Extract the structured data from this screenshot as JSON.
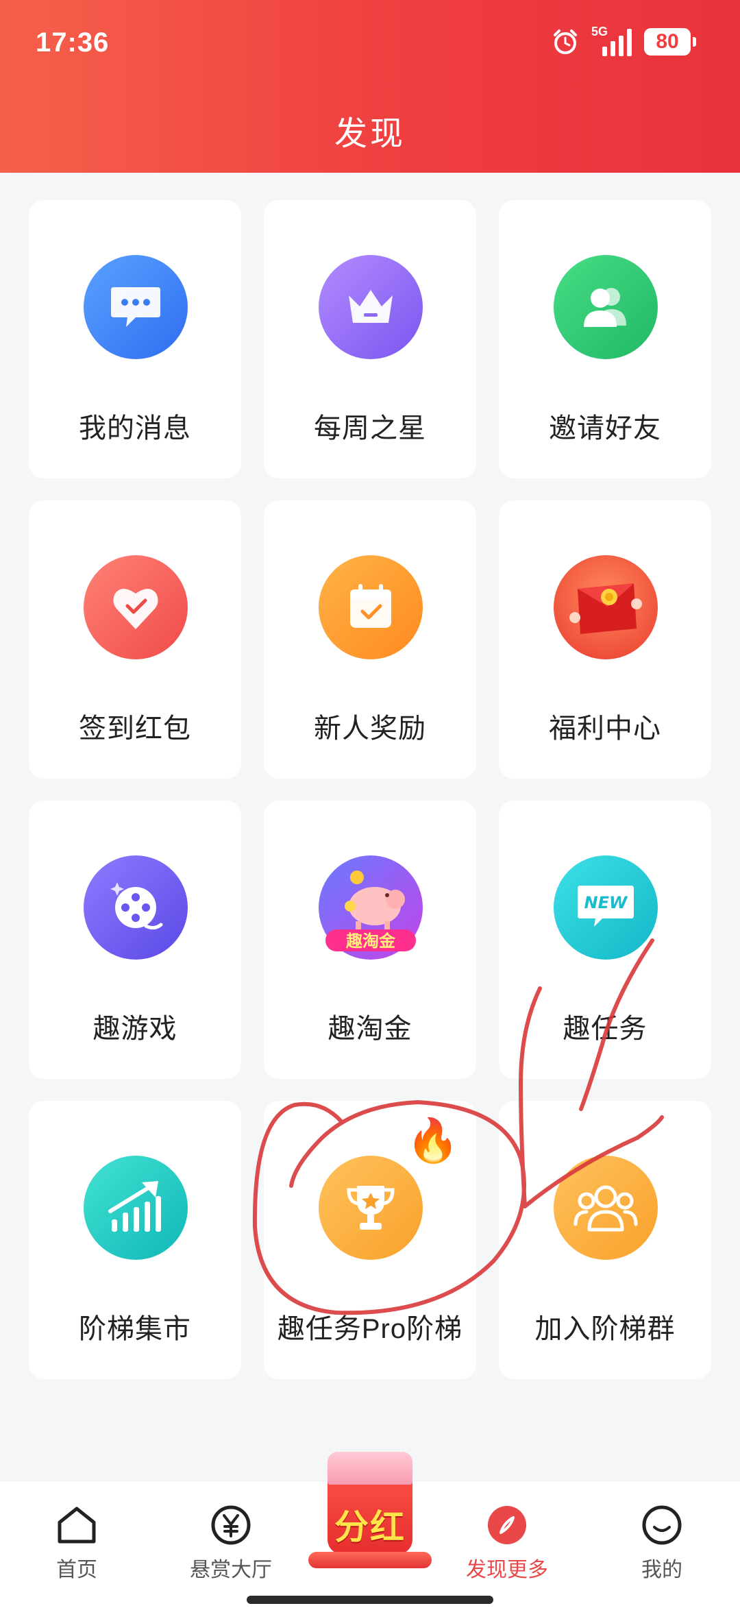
{
  "status_bar": {
    "time": "17:36",
    "network": "5G",
    "battery": "80"
  },
  "header": {
    "title": "发现"
  },
  "colors": {
    "header_start": "#f6604a",
    "header_end": "#e8323b",
    "accent_red": "#e84848",
    "annotation_red": "#d9393a"
  },
  "grid": {
    "items": [
      {
        "label": "我的消息",
        "icon": "chat-bubble-icon"
      },
      {
        "label": "每周之星",
        "icon": "crown-icon"
      },
      {
        "label": "邀请好友",
        "icon": "people-icon"
      },
      {
        "label": "签到红包",
        "icon": "heart-check-icon"
      },
      {
        "label": "新人奖励",
        "icon": "calendar-check-icon"
      },
      {
        "label": "福利中心",
        "icon": "red-envelope-icon"
      },
      {
        "label": "趣游戏",
        "icon": "film-reel-icon"
      },
      {
        "label": "趣淘金",
        "icon": "pig-coin-icon",
        "badge_text": "趣淘金"
      },
      {
        "label": "趣任务",
        "icon": "new-speech-icon",
        "badge_text": "NEW"
      },
      {
        "label": "阶梯集市",
        "icon": "growth-chart-icon"
      },
      {
        "label": "趣任务Pro阶梯",
        "icon": "trophy-icon",
        "hot": "fire-icon"
      },
      {
        "label": "加入阶梯群",
        "icon": "group-icon"
      }
    ]
  },
  "bottom_nav": {
    "items": [
      {
        "label": "首页",
        "icon": "home-icon"
      },
      {
        "label": "悬赏大厅",
        "icon": "yen-icon"
      },
      {
        "label": "发现更多",
        "icon": "compass-icon",
        "active": true
      },
      {
        "label": "我的",
        "icon": "smile-icon"
      }
    ],
    "center_button": {
      "label": "分红",
      "icon": "red-bag-icon"
    }
  }
}
